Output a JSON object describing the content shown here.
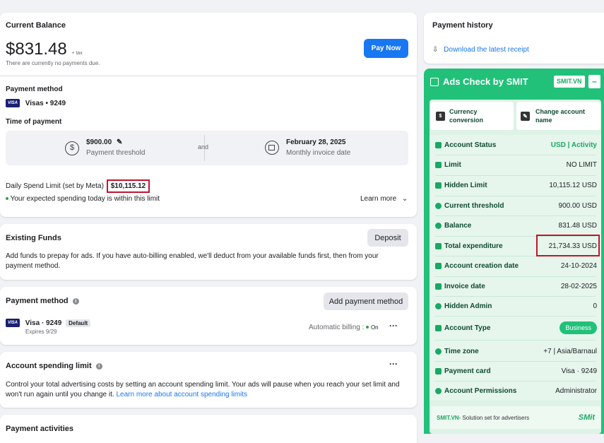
{
  "balance": {
    "title": "Current Balance",
    "amount": "$831.48",
    "tax": "+ tax",
    "note": "There are currently no payments due.",
    "pay_now": "Pay Now",
    "payment_method_label": "Payment method",
    "card": "Visas • 9249",
    "visa_badge": "VISA",
    "time_label": "Time of payment",
    "threshold_amount": "$900.00",
    "threshold_caption": "Payment threshold",
    "and": "and",
    "invoice_date": "February 28, 2025",
    "invoice_caption": "Monthly invoice date",
    "daily_limit_label": "Daily Spend Limit (set by Meta)",
    "daily_limit_value": "$10,115.12",
    "within_limit": "Your expected spending today is within this limit",
    "learn_more": "Learn more"
  },
  "funds": {
    "title": "Existing Funds",
    "deposit": "Deposit",
    "desc": "Add funds to prepay for ads. If you have auto-billing enabled, we'll deduct from your available funds first, then from your payment method."
  },
  "pm": {
    "title": "Payment method",
    "add": "Add payment method",
    "card": "Visa · 9249",
    "default": "Default",
    "expires": "Expires 9/29",
    "auto_billing": "Automatic billing :",
    "on": "On",
    "more": "···"
  },
  "asl": {
    "title": "Account spending limit",
    "more": "···",
    "desc": "Control your total advertising costs by setting an account spending limit. Your ads will pause when you reach your set limit and won't run again until you change it.",
    "link": "Learn more about account spending limits"
  },
  "activities": {
    "title": "Payment activities"
  },
  "history": {
    "title": "Payment history",
    "download": "Download the latest receipt"
  },
  "smit": {
    "title": "Ads Check by SMIT",
    "badge": "SMIT.VN",
    "minimize": "–",
    "currency_btn": "Currency conversion",
    "change_name_btn": "Change account name",
    "rows": [
      {
        "k": "Account Status",
        "v": "USD | Activity"
      },
      {
        "k": "Limit",
        "v": "NO LIMIT"
      },
      {
        "k": "Hidden Limit",
        "v": "10,115.12 USD"
      },
      {
        "k": "Current threshold",
        "v": "900.00 USD"
      },
      {
        "k": "Balance",
        "v": "831.48 USD"
      },
      {
        "k": "Total expenditure",
        "v": "21,734.33 USD"
      },
      {
        "k": "Account creation date",
        "v": "24-10-2024"
      },
      {
        "k": "Invoice date",
        "v": "28-02-2025"
      },
      {
        "k": "Hidden Admin",
        "v": "0"
      },
      {
        "k": "Account Type",
        "v": "Business"
      },
      {
        "k": "Time zone",
        "v": "+7 | Asia/Barnaul"
      },
      {
        "k": "Payment card",
        "v": "Visa · 9249"
      },
      {
        "k": "Account Permissions",
        "v": "Administrator"
      }
    ],
    "footer_brand": "SMIT.VN",
    "footer_text": " - Solution set for advertisers",
    "footer_logo": "SMit"
  },
  "colors": {
    "accent": "#1877f2",
    "smit_green": "#21c17a",
    "highlight": "#c0152f"
  }
}
